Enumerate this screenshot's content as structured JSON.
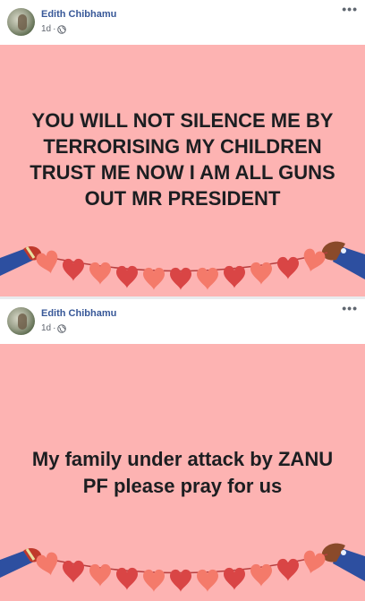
{
  "posts": [
    {
      "author": "Edith Chibhamu",
      "time": "1d",
      "dot": "·",
      "privacy_icon": "globe-icon",
      "more_icon": "more-options-icon",
      "more_glyph": "•••",
      "text": "YOU WILL NOT SILENCE ME BY TERRORISING MY CHILDREN TRUST ME NOW I AM ALL GUNS OUT MR PRESIDENT"
    },
    {
      "author": "Edith Chibhamu",
      "time": "1d",
      "dot": "·",
      "privacy_icon": "globe-icon",
      "more_icon": "more-options-icon",
      "more_glyph": "•••",
      "text": "My family under attack by ZANU PF please pray for us"
    }
  ],
  "colors": {
    "card_background": "#fdb3b2",
    "author_link": "#385898",
    "heart_dark": "#d94545",
    "heart_light": "#f47a6a"
  }
}
